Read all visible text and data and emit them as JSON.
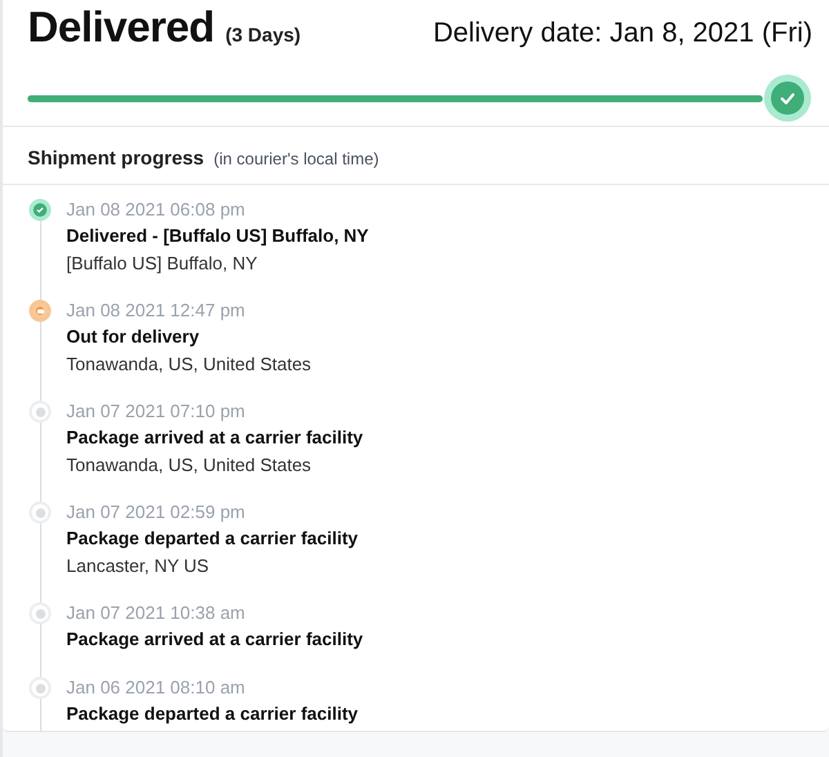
{
  "status": {
    "title": "Delivered",
    "duration": "(3 Days)",
    "delivery_date": "Delivery date: Jan 8, 2021 (Fri)",
    "level": 1
  },
  "section": {
    "title": "Shipment progress",
    "note": "(in courier's local time)"
  },
  "events": [
    {
      "kind": "delivered",
      "time": "Jan 08 2021 06:08 pm",
      "title": "Delivered - [Buffalo US] Buffalo, NY",
      "location": "[Buffalo US] Buffalo, NY"
    },
    {
      "kind": "current",
      "time": "Jan 08 2021 12:47 pm",
      "title": "Out for delivery",
      "location": "Tonawanda, US, United States"
    },
    {
      "kind": "past",
      "time": "Jan 07 2021 07:10 pm",
      "title": "Package arrived at a carrier facility",
      "location": "Tonawanda, US, United States"
    },
    {
      "kind": "past",
      "time": "Jan 07 2021 02:59 pm",
      "title": "Package departed a carrier facility",
      "location": "Lancaster, NY US"
    },
    {
      "kind": "past",
      "time": "Jan 07 2021 10:38 am",
      "title": "Package arrived at a carrier facility"
    },
    {
      "kind": "past",
      "time": "Jan 06 2021 08:10 am",
      "title": "Package departed a carrier facility"
    }
  ]
}
